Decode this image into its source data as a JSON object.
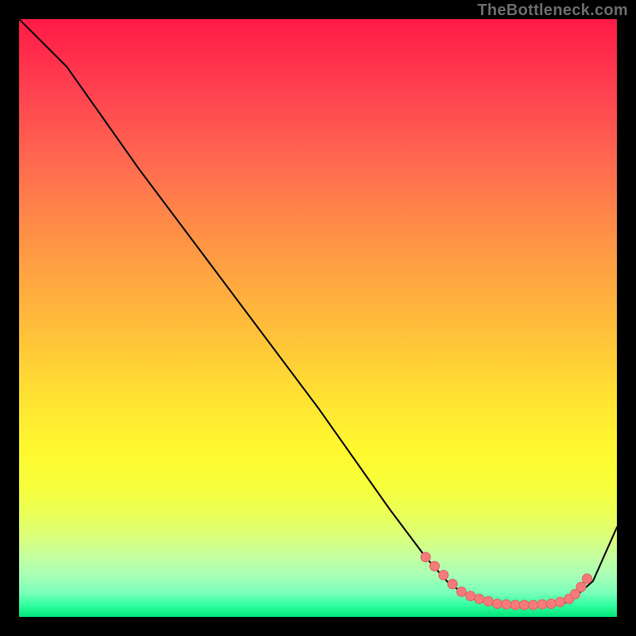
{
  "attribution": "TheBottleneck.com",
  "colors": {
    "background": "#000000",
    "gradient_top": "#ff1b47",
    "gradient_bottom": "#00e57a",
    "curve": "#111111",
    "marker_fill": "#f47b7a",
    "marker_stroke": "#e16060"
  },
  "chart_data": {
    "type": "line",
    "title": "",
    "xlabel": "",
    "ylabel": "",
    "xlim": [
      0,
      100
    ],
    "ylim": [
      0,
      100
    ],
    "series": [
      {
        "name": "bottleneck-curve",
        "x": [
          0,
          8,
          20,
          35,
          50,
          62,
          68,
          72,
          76,
          80,
          84,
          88,
          92,
          96,
          100
        ],
        "y": [
          100,
          92,
          75,
          55,
          35,
          18,
          10,
          5.5,
          3,
          2,
          2,
          2,
          2.5,
          6,
          15
        ]
      }
    ],
    "markers": {
      "name": "sample-points",
      "x": [
        68,
        69.5,
        71,
        72.5,
        74,
        75.5,
        77,
        78.5,
        80,
        81.5,
        83,
        84.5,
        86,
        87.5,
        89,
        90.5,
        92,
        93,
        94,
        95
      ],
      "y": [
        10,
        8.5,
        7,
        5.5,
        4.2,
        3.5,
        3,
        2.6,
        2.2,
        2.1,
        2,
        2,
        2,
        2.1,
        2.2,
        2.5,
        3,
        3.8,
        5,
        6.4
      ]
    }
  }
}
